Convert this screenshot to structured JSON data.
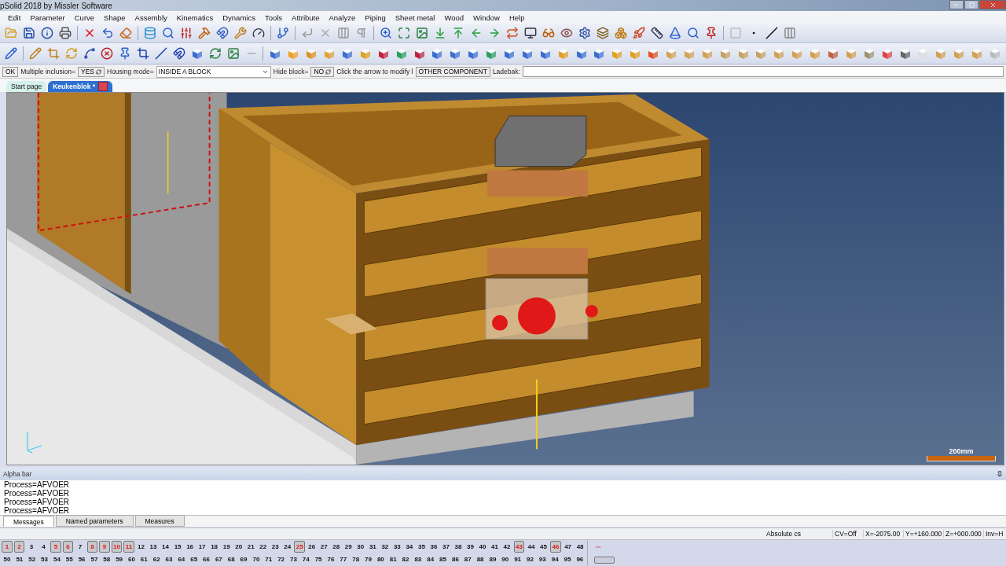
{
  "window": {
    "title": "pSolid 2018 by Missler Software"
  },
  "menu": [
    "Edit",
    "Parameter",
    "Curve",
    "Shape",
    "Assembly",
    "Kinematics",
    "Dynamics",
    "Tools",
    "Attribute",
    "Analyze",
    "Piping",
    "Sheet metal",
    "Wood",
    "Window",
    "Help"
  ],
  "dialog_bar": {
    "ok": "OK",
    "multiple_inclusion": {
      "label": "Multiple inclusion=",
      "value": "YES"
    },
    "housing_mode": {
      "label": "Housing mode=",
      "value": "INSIDE A BLOCK"
    },
    "hide_block": {
      "label": "Hide block=",
      "value": "NO"
    },
    "hint": "Click the arrow to modify l",
    "component_button": "OTHER COMPONENT",
    "ladebak": {
      "label": "Ladebak:"
    }
  },
  "document_tabs": [
    {
      "label": "Start page",
      "selected": false
    },
    {
      "label": "Keukenblok *",
      "selected": true
    }
  ],
  "viewport": {
    "scale": "200mm"
  },
  "alpha_bar": {
    "title": "Alpha bar",
    "messages": [
      "Process=AFVOER",
      "Process=AFVOER",
      "Process=AFVOER",
      "Process=AFVOER"
    ]
  },
  "message_tabs": [
    {
      "label": "Messages",
      "selected": true
    },
    {
      "label": "Named parameters",
      "selected": false
    },
    {
      "label": "Measures",
      "selected": false
    }
  ],
  "status": {
    "cs": "Absolute cs",
    "fields": [
      "CV=Off",
      "X=-2075.00",
      "Y=+160.000",
      "Z=+000.000",
      "Inv=H"
    ]
  },
  "layers": [
    [
      {
        "label": "1",
        "selected": true
      },
      {
        "label": "2",
        "selected": true
      },
      {
        "label": "3",
        "selected": false
      },
      {
        "label": "4",
        "selected": false
      },
      {
        "label": "5",
        "selected": true
      },
      {
        "label": "6",
        "selected": true
      },
      {
        "label": "7",
        "selected": false
      },
      {
        "label": "8",
        "selected": true
      },
      {
        "label": "9",
        "selected": true
      },
      {
        "label": "10",
        "selected": true
      },
      {
        "label": "11",
        "selected": true
      },
      {
        "label": "12",
        "selected": false
      },
      {
        "label": "13",
        "selected": false
      },
      {
        "label": "14",
        "selected": false
      },
      {
        "label": "15",
        "selected": false
      },
      {
        "label": "16",
        "selected": false
      },
      {
        "label": "17",
        "selected": false
      },
      {
        "label": "18",
        "selected": false
      },
      {
        "label": "19",
        "selected": false
      },
      {
        "label": "20",
        "selected": false
      },
      {
        "label": "21",
        "selected": false
      },
      {
        "label": "22",
        "selected": false
      },
      {
        "label": "23",
        "selected": false
      },
      {
        "label": "24",
        "selected": false
      },
      {
        "label": "25",
        "selected": true
      },
      {
        "label": "26",
        "selected": false
      },
      {
        "label": "27",
        "selected": false
      },
      {
        "label": "28",
        "selected": false
      },
      {
        "label": "29",
        "selected": false
      },
      {
        "label": "30",
        "selected": false
      },
      {
        "label": "31",
        "selected": false
      },
      {
        "label": "32",
        "selected": false
      },
      {
        "label": "33",
        "selected": false
      },
      {
        "label": "34",
        "selected": false
      },
      {
        "label": "35",
        "selected": false
      },
      {
        "label": "36",
        "selected": false
      },
      {
        "label": "37",
        "selected": false
      },
      {
        "label": "38",
        "selected": false
      },
      {
        "label": "39",
        "selected": false
      },
      {
        "label": "40",
        "selected": false
      },
      {
        "label": "41",
        "selected": false
      },
      {
        "label": "42",
        "selected": false
      },
      {
        "label": "43",
        "selected": true
      },
      {
        "label": "44",
        "selected": false
      },
      {
        "label": "45",
        "selected": false
      },
      {
        "label": "46",
        "selected": true
      },
      {
        "label": "47",
        "selected": false
      },
      {
        "label": "48",
        "selected": false
      }
    ],
    [
      {
        "label": "50",
        "selected": false
      },
      {
        "label": "51",
        "selected": false
      },
      {
        "label": "52",
        "selected": false
      },
      {
        "label": "53",
        "selected": false
      },
      {
        "label": "54",
        "selected": false
      },
      {
        "label": "55",
        "selected": false
      },
      {
        "label": "56",
        "selected": false
      },
      {
        "label": "57",
        "selected": false
      },
      {
        "label": "58",
        "selected": false
      },
      {
        "label": "59",
        "selected": false
      },
      {
        "label": "60",
        "selected": false
      },
      {
        "label": "61",
        "selected": false
      },
      {
        "label": "62",
        "selected": false
      },
      {
        "label": "63",
        "selected": false
      },
      {
        "label": "64",
        "selected": false
      },
      {
        "label": "65",
        "selected": false
      },
      {
        "label": "66",
        "selected": false
      },
      {
        "label": "67",
        "selected": false
      },
      {
        "label": "68",
        "selected": false
      },
      {
        "label": "69",
        "selected": false
      },
      {
        "label": "70",
        "selected": false
      },
      {
        "label": "71",
        "selected": false
      },
      {
        "label": "72",
        "selected": false
      },
      {
        "label": "73",
        "selected": false
      },
      {
        "label": "74",
        "selected": false
      },
      {
        "label": "75",
        "selected": false
      },
      {
        "label": "76",
        "selected": false
      },
      {
        "label": "77",
        "selected": false
      },
      {
        "label": "78",
        "selected": false
      },
      {
        "label": "79",
        "selected": false
      },
      {
        "label": "80",
        "selected": false
      },
      {
        "label": "81",
        "selected": false
      },
      {
        "label": "82",
        "selected": false
      },
      {
        "label": "83",
        "selected": false
      },
      {
        "label": "84",
        "selected": false
      },
      {
        "label": "85",
        "selected": false
      },
      {
        "label": "86",
        "selected": false
      },
      {
        "label": "87",
        "selected": false
      },
      {
        "label": "88",
        "selected": false
      },
      {
        "label": "89",
        "selected": false
      },
      {
        "label": "90",
        "selected": false
      },
      {
        "label": "91",
        "selected": false
      },
      {
        "label": "92",
        "selected": false
      },
      {
        "label": "93",
        "selected": false
      },
      {
        "label": "94",
        "selected": false
      },
      {
        "label": "95",
        "selected": false
      },
      {
        "label": "96",
        "selected": false
      }
    ]
  ]
}
